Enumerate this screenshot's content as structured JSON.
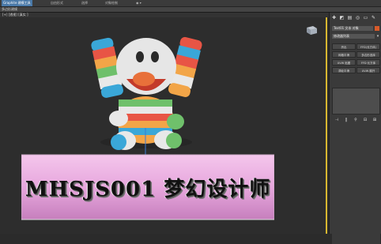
{
  "menubar": {
    "items": [
      {
        "label": "Graphite 建模工具",
        "active": true
      },
      {
        "label": "自由形式",
        "active": false
      },
      {
        "label": "选择",
        "active": false
      },
      {
        "label": "对象绘制",
        "active": false
      },
      {
        "label": "◉ ▾",
        "active": false
      }
    ]
  },
  "ribbon": {
    "label": "多边形建模"
  },
  "viewport": {
    "label": "[+] [透视] [真实 ]"
  },
  "banner": {
    "text": "MHSJS001 梦幻设计师"
  },
  "command_panel": {
    "tab_icons": [
      "✚",
      "◩",
      "▤",
      "◎",
      "▭",
      "✎"
    ],
    "object_name": "Text01 文本 对象",
    "object_color": "#d85a2a",
    "modifier_list": "修改器列表",
    "modifier_buttons": [
      [
        "挤出",
        "FFD(长方体)"
      ],
      [
        "网格平滑",
        "多边形选择"
      ],
      [
        "UVW 贴图",
        "FFD 长方体"
      ],
      [
        "涡轮平滑",
        "UVW 展开"
      ]
    ],
    "stack_tools": [
      "⊣",
      "‖",
      "⚲",
      "⊟",
      "⊞"
    ]
  }
}
